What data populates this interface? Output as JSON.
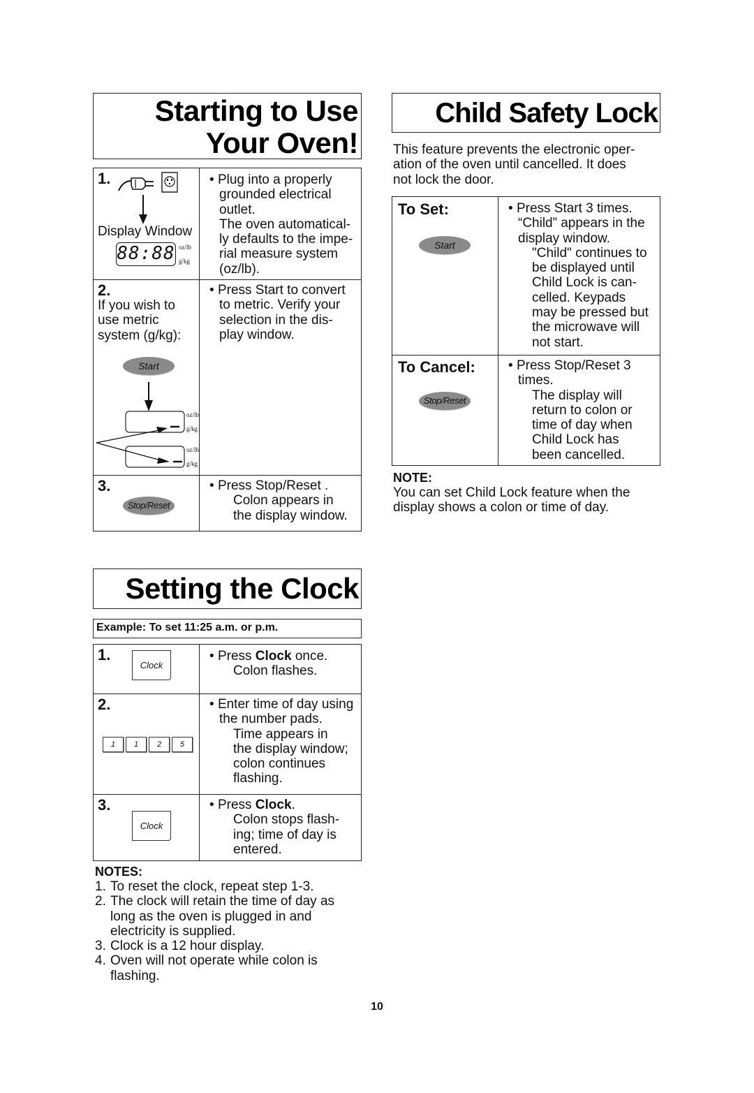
{
  "starting": {
    "title_line1": "Starting to Use",
    "title_line2": "Your Oven!",
    "steps": [
      {
        "num": "1.",
        "left_caption": "Display Window",
        "display_digits": "88:88",
        "unit_imperial": "oz/lb",
        "unit_metric": "g/kg",
        "bullet": "Plug into a properly grounded electrical outlet.",
        "detail": "The oven automatical-ly defaults to the impe-rial measure system (oz/lb).",
        "lines": [
          "Plug into a properly",
          "grounded electrical",
          "outlet.",
          "The oven automatical-",
          "ly defaults to the impe-",
          "rial measure system",
          "(oz/lb)."
        ]
      },
      {
        "num": "2.",
        "left_lines": [
          "If you wish to",
          "use metric",
          "system (g/kg):"
        ],
        "button": "Start",
        "lines": [
          "Press Start  to convert",
          "to metric. Verify your",
          "selection in the dis-",
          "play window."
        ]
      },
      {
        "num": "3.",
        "button": "Stop/Reset",
        "lines": [
          "Press Stop/Reset .",
          "Colon appears in",
          "the display window."
        ]
      }
    ]
  },
  "child_lock": {
    "title": "Child Safety Lock",
    "intro_lines": [
      "This feature prevents the electronic oper-",
      "ation of the oven until cancelled. It does",
      "not lock the door."
    ],
    "to_set": {
      "label": "To Set:",
      "button": "Start",
      "lines": [
        "Press Start  3 times.",
        "“Child” appears in the",
        "display window."
      ],
      "sub_lines": [
        "\"Child\" continues to",
        "be displayed until",
        "Child Lock is can-",
        "celled. Keypads",
        "may be pressed but",
        "the microwave will",
        "not start."
      ]
    },
    "to_cancel": {
      "label": "To Cancel:",
      "button": "Stop/Reset",
      "lines": [
        "Press Stop/Reset  3",
        "times."
      ],
      "sub_lines": [
        "The display will",
        "return to colon or",
        "time of day when",
        "Child Lock has",
        "been cancelled."
      ]
    },
    "note_heading": "NOTE:",
    "note_lines": [
      "You can set Child Lock feature when the",
      "display shows a colon or time of day."
    ]
  },
  "clock": {
    "title": "Setting the Clock",
    "example": "Example: To set 11:25 a.m. or p.m.",
    "steps": [
      {
        "num": "1.",
        "keypad": "Clock",
        "pre": "Press ",
        "bold": "Clock",
        "post": " once.",
        "sub_lines": [
          "Colon flashes."
        ]
      },
      {
        "num": "2.",
        "numpads": [
          "1",
          "1",
          "2",
          "5"
        ],
        "lines": [
          "Enter time of day using",
          "the number pads."
        ],
        "sub_lines": [
          "Time appears in",
          "the display window;",
          "colon continues",
          "flashing."
        ]
      },
      {
        "num": "3.",
        "keypad": "Clock",
        "pre": "Press ",
        "bold": "Clock",
        "post": ".",
        "sub_lines": [
          "Colon stops flash-",
          "ing; time of day is",
          "entered."
        ]
      }
    ],
    "notes_heading": "NOTES:",
    "notes": [
      {
        "num": "1.",
        "lines": [
          "To reset the clock, repeat step 1-3."
        ]
      },
      {
        "num": "2.",
        "lines": [
          "The clock will retain the time of day as",
          "long as the oven is plugged in and",
          "electricity is supplied."
        ]
      },
      {
        "num": "3.",
        "lines": [
          "Clock is a 12 hour display."
        ]
      },
      {
        "num": "4.",
        "lines": [
          "Oven will not operate while colon is",
          "flashing."
        ]
      }
    ]
  },
  "page_number": "10",
  "colors": {
    "button_fill": "#8a8a8a",
    "border": "#222222",
    "text": "#111111"
  }
}
